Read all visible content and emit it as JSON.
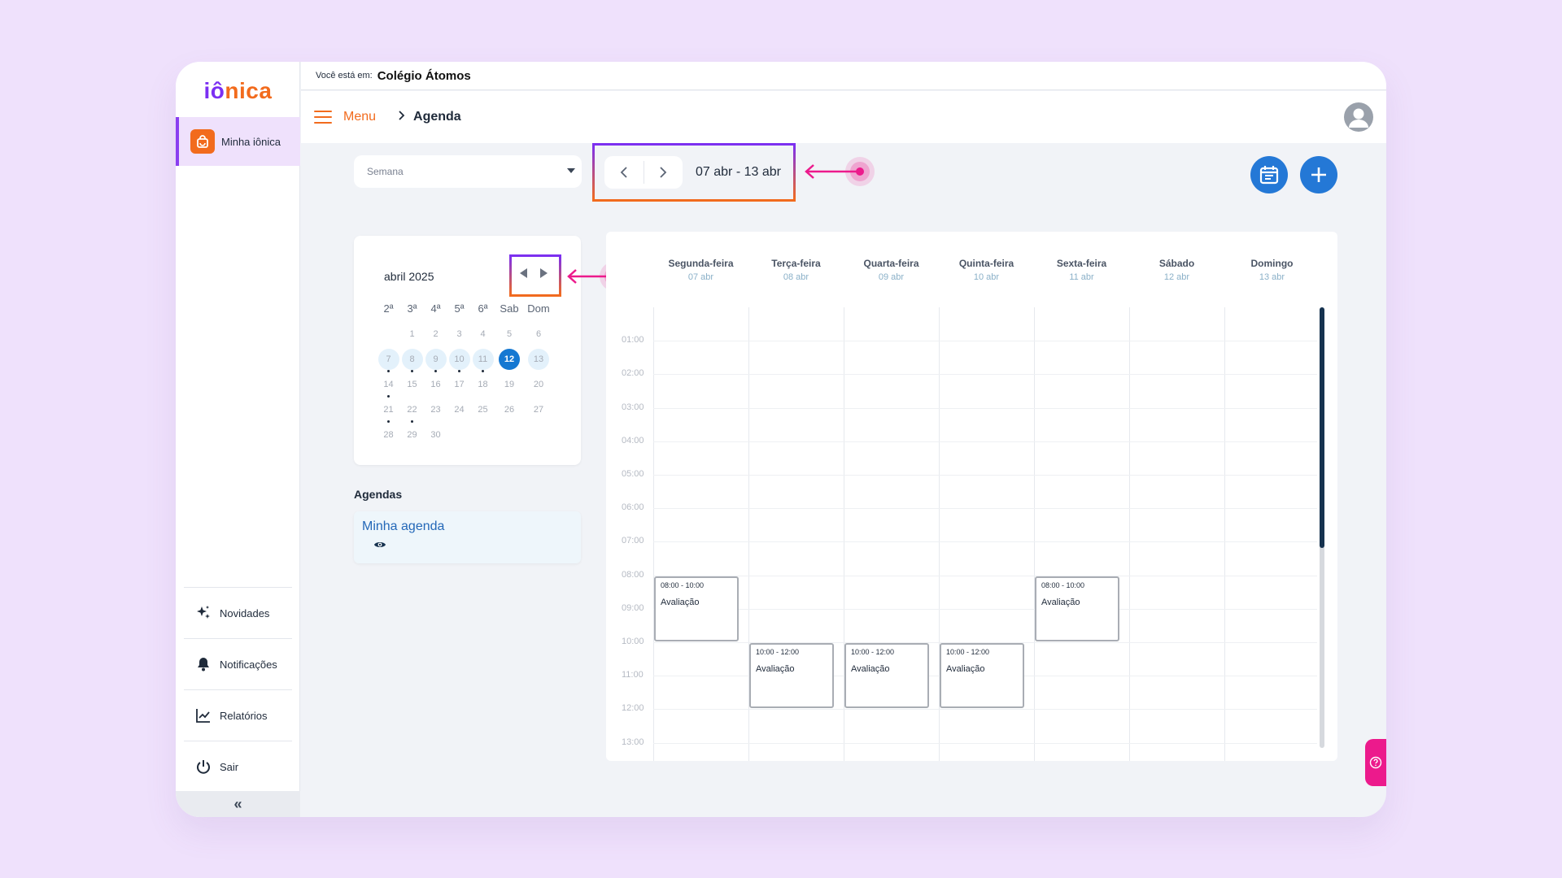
{
  "colors": {
    "accent": "#f26b1d",
    "brand_purple": "#7b2ff2",
    "primary_blue": "#2478d6",
    "annotation_pink": "#ec1a8c"
  },
  "sidebar": {
    "logo_part1": "iô",
    "logo_part2": "nica",
    "active_item": {
      "label": "Minha iônica",
      "icon": "bag-icon"
    },
    "bottom_items": [
      {
        "label": "Novidades",
        "icon": "sparkles-icon"
      },
      {
        "label": "Notificações",
        "icon": "bell-icon"
      },
      {
        "label": "Relatórios",
        "icon": "chart-icon"
      },
      {
        "label": "Sair",
        "icon": "power-icon"
      }
    ],
    "collapse_label": "«"
  },
  "header": {
    "location_prefix": "Você está em:",
    "school": "Colégio Átomos",
    "menu_label": "Menu",
    "breadcrumb": "Agenda"
  },
  "controls": {
    "view_select": "Semana",
    "range": "07 abr - 13 abr"
  },
  "mini_calendar": {
    "month": "abril 2025",
    "weekdays": [
      "2ª",
      "3ª",
      "4ª",
      "5ª",
      "6ª",
      "Sab",
      "Dom"
    ],
    "weeks": [
      [
        "",
        "1",
        "2",
        "3",
        "4",
        "5",
        "6"
      ],
      [
        "7",
        "8",
        "9",
        "10",
        "11",
        "12",
        "13"
      ],
      [
        "14",
        "15",
        "16",
        "17",
        "18",
        "19",
        "20"
      ],
      [
        "21",
        "22",
        "23",
        "24",
        "25",
        "26",
        "27"
      ],
      [
        "28",
        "29",
        "30",
        "",
        "",
        "",
        ""
      ]
    ],
    "selected_week": 1,
    "today": "12",
    "days_with_events": [
      "7",
      "8",
      "9",
      "10",
      "11",
      "14",
      "21",
      "22"
    ]
  },
  "agendas": {
    "title": "Agendas",
    "items": [
      {
        "name": "Minha agenda"
      }
    ]
  },
  "week": {
    "days": [
      {
        "name": "Segunda-feira",
        "date": "07 abr"
      },
      {
        "name": "Terça-feira",
        "date": "08 abr"
      },
      {
        "name": "Quarta-feira",
        "date": "09 abr"
      },
      {
        "name": "Quinta-feira",
        "date": "10 abr"
      },
      {
        "name": "Sexta-feira",
        "date": "11 abr"
      },
      {
        "name": "Sábado",
        "date": "12 abr"
      },
      {
        "name": "Domingo",
        "date": "13 abr"
      }
    ],
    "hours": [
      "01:00",
      "02:00",
      "03:00",
      "04:00",
      "05:00",
      "06:00",
      "07:00",
      "08:00",
      "09:00",
      "10:00",
      "11:00",
      "12:00",
      "13:00"
    ],
    "events": [
      {
        "day": 0,
        "start": 8,
        "time": "08:00 - 10:00",
        "title": "Avaliação"
      },
      {
        "day": 1,
        "start": 10,
        "time": "10:00 - 12:00",
        "title": "Avaliação"
      },
      {
        "day": 2,
        "start": 10,
        "time": "10:00 - 12:00",
        "title": "Avaliação"
      },
      {
        "day": 3,
        "start": 10,
        "time": "10:00 - 12:00",
        "title": "Avaliação"
      },
      {
        "day": 4,
        "start": 8,
        "time": "08:00 - 10:00",
        "title": "Avaliação"
      }
    ]
  }
}
